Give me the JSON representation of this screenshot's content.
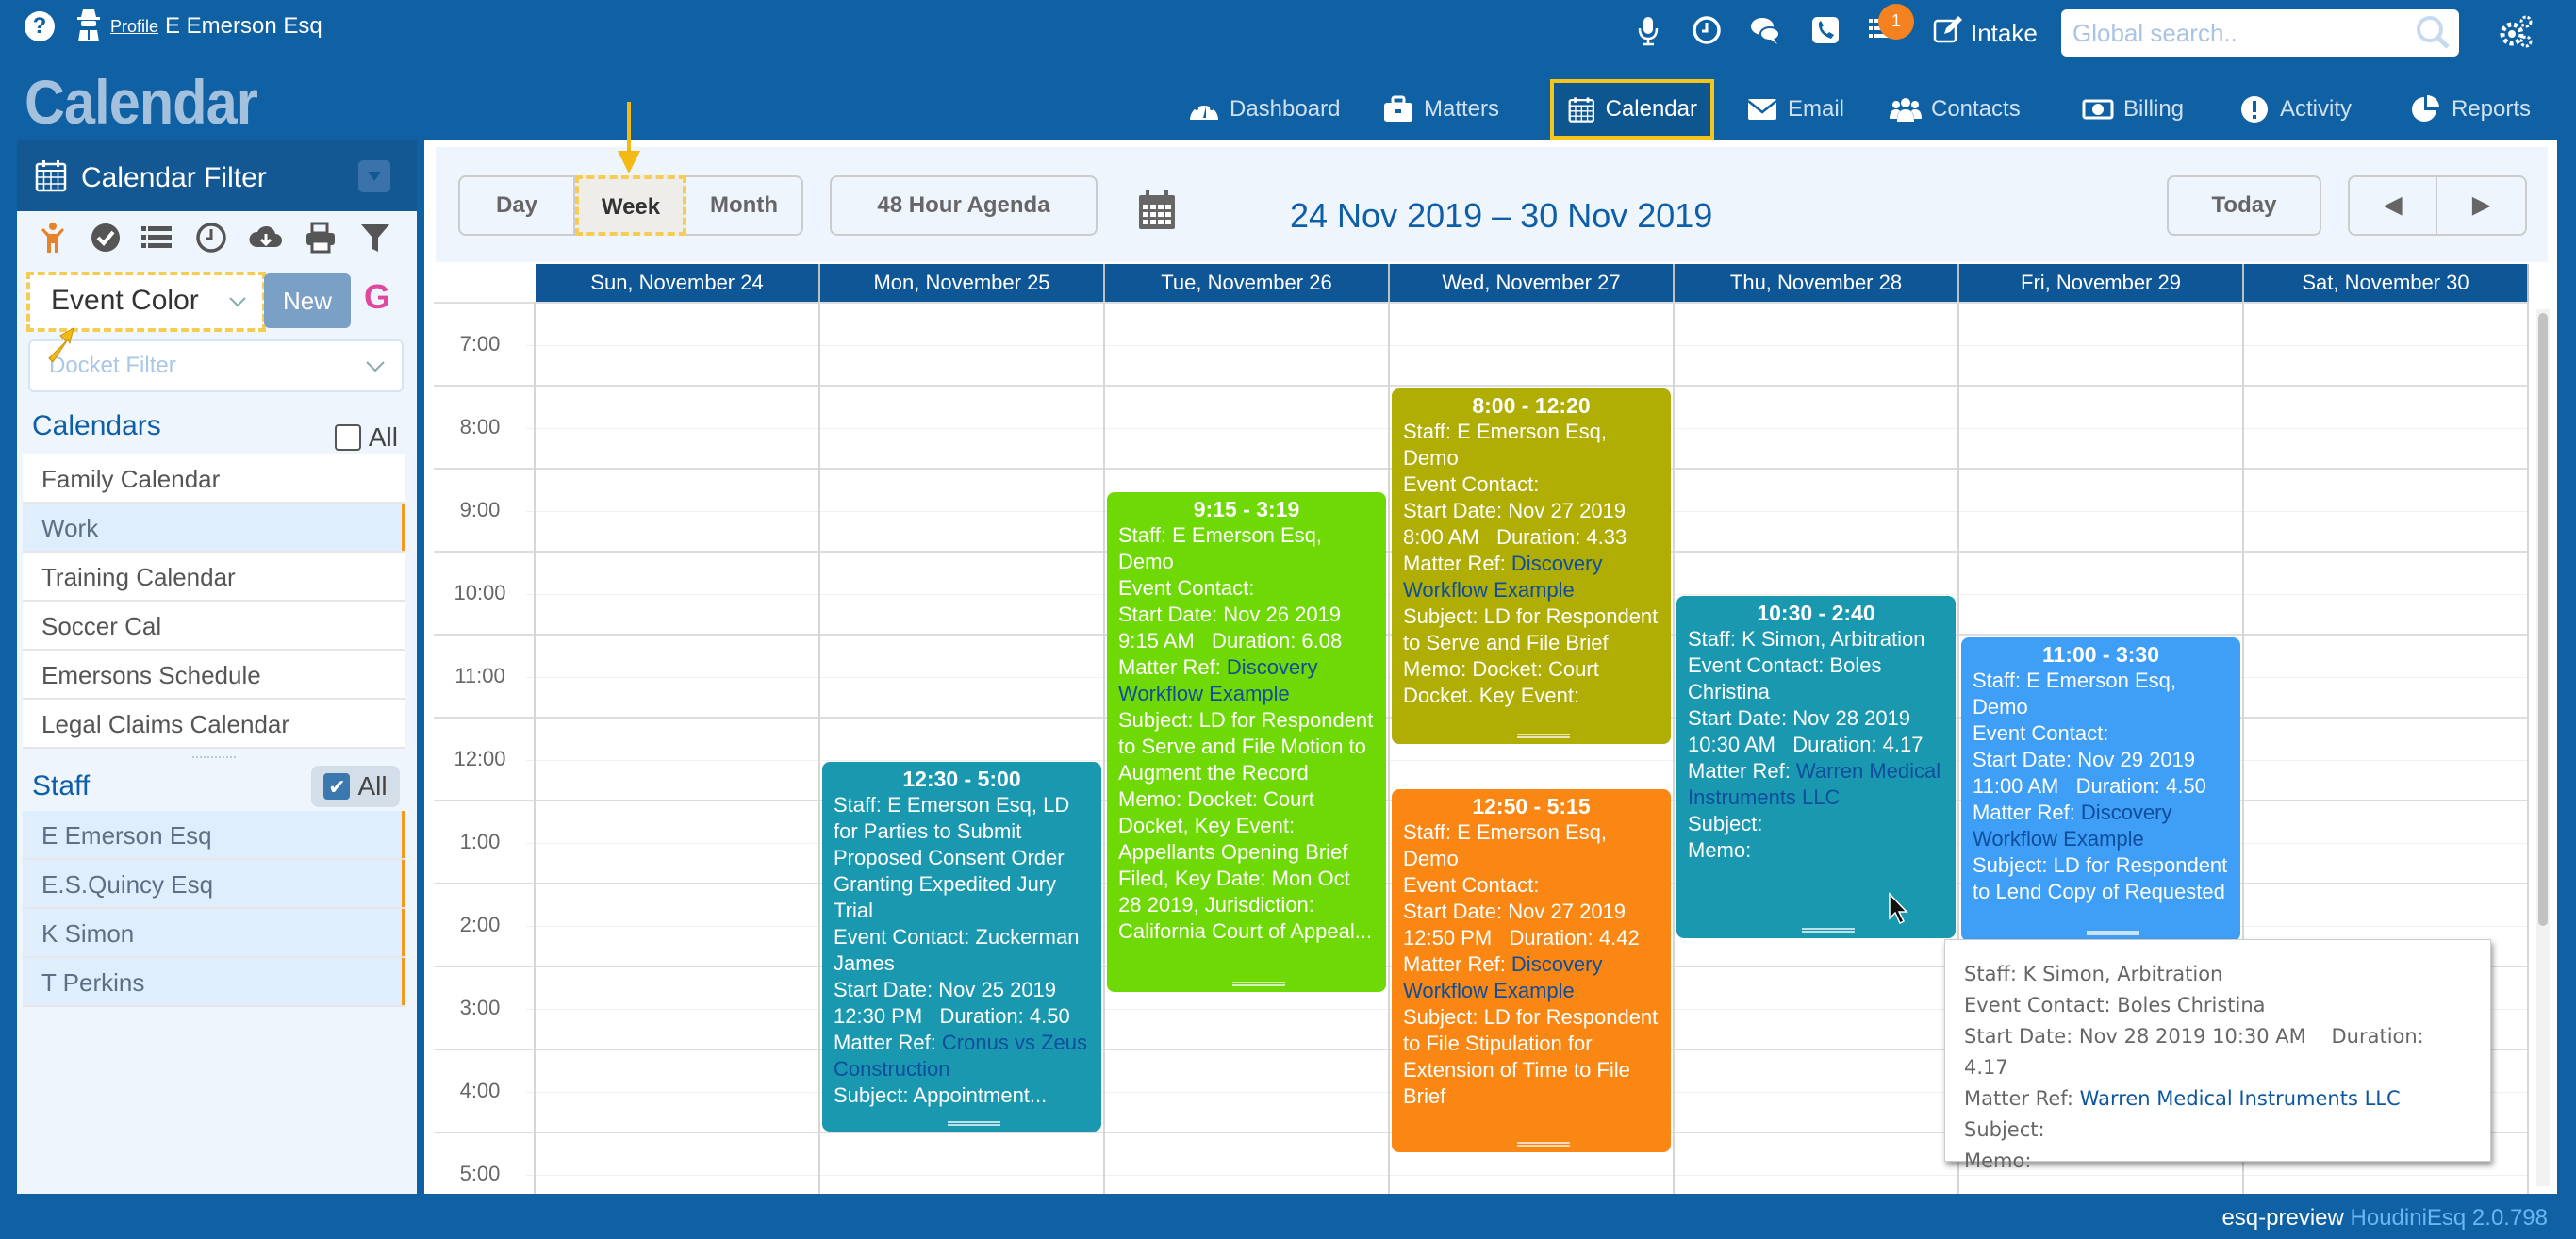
{
  "header": {
    "profile_link": "Profile",
    "user_name": "E Emerson Esq",
    "notification_count": "1",
    "intake_label": "Intake",
    "search_placeholder": "Global search..",
    "app_title": "Calendar"
  },
  "nav": [
    {
      "label": "Dashboard",
      "icon": "dashboard-icon"
    },
    {
      "label": "Matters",
      "icon": "briefcase-icon"
    },
    {
      "label": "Calendar",
      "icon": "calendar-icon",
      "active": true
    },
    {
      "label": "Email",
      "icon": "envelope-icon"
    },
    {
      "label": "Contacts",
      "icon": "users-icon"
    },
    {
      "label": "Billing",
      "icon": "money-icon"
    },
    {
      "label": "Activity",
      "icon": "exclamation-icon"
    },
    {
      "label": "Reports",
      "icon": "pie-chart-icon"
    }
  ],
  "sidebar": {
    "title": "Calendar Filter",
    "color_select": "Event Color",
    "new_label": "New",
    "google_label": "G",
    "docket_placeholder": "Docket Filter",
    "calendars_title": "Calendars",
    "all_label": "All",
    "calendars": [
      {
        "label": "Family Calendar",
        "selected": false
      },
      {
        "label": "Work",
        "selected": true
      },
      {
        "label": "Training Calendar",
        "selected": false
      },
      {
        "label": "Soccer Cal",
        "selected": false
      },
      {
        "label": "Emersons Schedule",
        "selected": false
      },
      {
        "label": "Legal Claims Calendar",
        "selected": false
      }
    ],
    "staff_title": "Staff",
    "staff_all_label": "All",
    "staff_all_checked": true,
    "staff": [
      {
        "label": "E Emerson Esq",
        "selected": true
      },
      {
        "label": "E.S.Quincy Esq",
        "selected": true
      },
      {
        "label": "K Simon",
        "selected": true
      },
      {
        "label": "T Perkins",
        "selected": true
      }
    ]
  },
  "toolbar": {
    "day": "Day",
    "week": "Week",
    "month": "Month",
    "agenda": "48 Hour Agenda",
    "date_range": "24 Nov 2019 – 30 Nov 2019",
    "today": "Today",
    "prev": "◀",
    "next": "▶"
  },
  "days": [
    "Sun, November 24",
    "Mon, November 25",
    "Tue, November 26",
    "Wed, November 27",
    "Thu, November 28",
    "Fri, November 29",
    "Sat, November 30"
  ],
  "hours": [
    "7:00",
    "8:00",
    "9:00",
    "10:00",
    "11:00",
    "12:00",
    "1:00",
    "2:00",
    "3:00",
    "4:00",
    "5:00"
  ],
  "events": [
    {
      "day": 1,
      "start": 12.5,
      "visible_end": 17.0,
      "color": "#1a98b0",
      "time": "12:30 - 5:00",
      "lines": [
        "Staff: E Emerson Esq, LD for Parties to Submit Proposed Consent Order Granting Expedited Jury Trial",
        "Event Contact: Zuckerman James",
        "Start Date: Nov 25 2019 12:30 PM   Duration: 4.50"
      ],
      "matter_label": "Matter Ref: ",
      "matter": "Cronus vs Zeus Construction",
      "tail": [
        "Subject: Appointment..."
      ]
    },
    {
      "day": 2,
      "start": 9.25,
      "visible_end": 15.32,
      "color": "#6fd905",
      "time": "9:15 - 3:19",
      "lines": [
        "Staff: E Emerson Esq, Demo",
        "Event Contact:",
        "Start Date: Nov 26 2019 9:15 AM   Duration: 6.08"
      ],
      "matter_label": "Matter Ref: ",
      "matter": "Discovery Workflow Example",
      "tail": [
        "Subject: LD for Respondent to Serve and File Motion to Augment the Record",
        "Memo: Docket: Court Docket, Key Event: Appellants Opening Brief Filed, Key Date: Mon Oct 28 2019, Jurisdiction: California Court of Appeal..."
      ]
    },
    {
      "day": 3,
      "start": 8.0,
      "visible_end": 12.33,
      "color": "#b0ad05",
      "time": "8:00 - 12:20",
      "lines": [
        "Staff: E Emerson Esq, Demo",
        "Event Contact:",
        "Start Date: Nov 27 2019 8:00 AM   Duration: 4.33"
      ],
      "matter_label": "Matter Ref: ",
      "matter": "Discovery Workflow Example",
      "tail": [
        "Subject: LD for Respondent to Serve and File Brief",
        "Memo: Docket: Court Docket. Key Event:"
      ]
    },
    {
      "day": 3,
      "start": 12.83,
      "visible_end": 17.25,
      "color": "#fa8714",
      "time": "12:50 - 5:15",
      "lines": [
        "Staff: E Emerson Esq, Demo",
        "Event Contact:",
        "Start Date: Nov 27 2019 12:50 PM   Duration: 4.42"
      ],
      "matter_label": "Matter Ref: ",
      "matter": "Discovery Workflow Example",
      "tail": [
        "Subject: LD for Respondent to File Stipulation for Extension of Time to File Brief"
      ]
    },
    {
      "day": 4,
      "start": 10.5,
      "visible_end": 14.67,
      "color": "#1a98b0",
      "time": "10:30 - 2:40",
      "lines": [
        "Staff: K Simon, Arbitration",
        "Event Contact: Boles Christina",
        "Start Date: Nov 28 2019 10:30 AM   Duration: 4.17"
      ],
      "matter_label": "Matter Ref: ",
      "matter": "Warren Medical Instruments LLC",
      "tail": [
        "Subject:",
        "Memo:"
      ]
    },
    {
      "day": 5,
      "start": 11.0,
      "visible_end": 14.7,
      "color": "#3f9ff7",
      "time": "11:00 - 3:30",
      "lines": [
        "Staff: E Emerson Esq, Demo",
        "Event Contact:",
        "Start Date: Nov 29 2019 11:00 AM   Duration: 4.50"
      ],
      "matter_label": "Matter Ref: ",
      "matter": "Discovery Workflow Example",
      "tail": [
        "Subject: LD for Respondent to Lend Copy of Requested"
      ]
    }
  ],
  "tooltip": {
    "staff": "Staff: K Simon, Arbitration",
    "contact": "Event Contact: Boles Christina",
    "start": "Start Date: Nov 28 2019 10:30 AM    Duration: 4.17",
    "matter_label": "Matter Ref: ",
    "matter": "Warren Medical Instruments LLC",
    "subject": "Subject:",
    "memo": "Memo:"
  },
  "footer": {
    "env": "esq-preview",
    "version": "HoudiniEsq 2.0.798"
  }
}
